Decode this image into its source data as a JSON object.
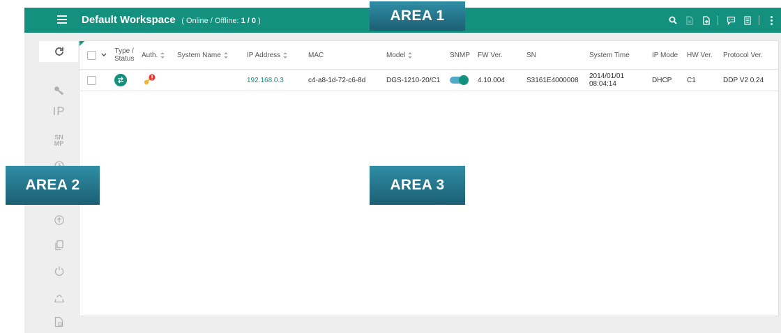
{
  "header": {
    "title": "Default Workspace",
    "status_prefix": "( Online / Offline: ",
    "status_value": "1 / 0",
    "status_suffix": " )"
  },
  "areas": {
    "area1": "AREA 1",
    "area2": "AREA 2",
    "area3": "AREA 3"
  },
  "colors": {
    "brand_teal": "#13917e",
    "area_label_blue": "#1c5f74",
    "auth_key": "#f2b42d",
    "auth_alert": "#e53935"
  },
  "header_icons": [
    "search-icon",
    "document-icon",
    "export-icon",
    "message-icon",
    "log-icon",
    "more-vert-icon"
  ],
  "sidebar": {
    "refresh_icon": "refresh-icon",
    "ip_label": "IP",
    "snmp_line1": "SN",
    "snmp_line2": "MP",
    "icons": [
      "key-icon",
      "ip-icon",
      "snmp-icon",
      "clock-icon",
      "upload-icon",
      "copy-icon",
      "power-icon",
      "reset-icon",
      "file-icon"
    ]
  },
  "table": {
    "columns": {
      "type_line1": "Type /",
      "type_line2": "Status",
      "auth": "Auth.",
      "system_name": "System Name",
      "ip_address": "IP Address",
      "mac": "MAC",
      "model": "Model",
      "snmp": "SNMP",
      "fw_ver": "FW Ver.",
      "sn": "SN",
      "system_time": "System Time",
      "ip_mode": "IP Mode",
      "hw_ver": "HW Ver.",
      "protocol_ver": "Protocol Ver."
    },
    "rows": [
      {
        "selected": false,
        "type_icon": "switch-icon",
        "auth_icon": "key-alert-icon",
        "system_name": "",
        "ip_address": "192.168.0.3",
        "mac": "c4-a8-1d-72-c6-8d",
        "model": "DGS-1210-20/C1",
        "snmp_enabled": true,
        "fw_ver": "4.10.004",
        "sn": "S3161E4000008",
        "system_time_date": "2014/01/01",
        "system_time_time": "08:04:14",
        "ip_mode": "DHCP",
        "hw_ver": "C1",
        "protocol_ver": "DDP V2 0.24"
      }
    ]
  }
}
